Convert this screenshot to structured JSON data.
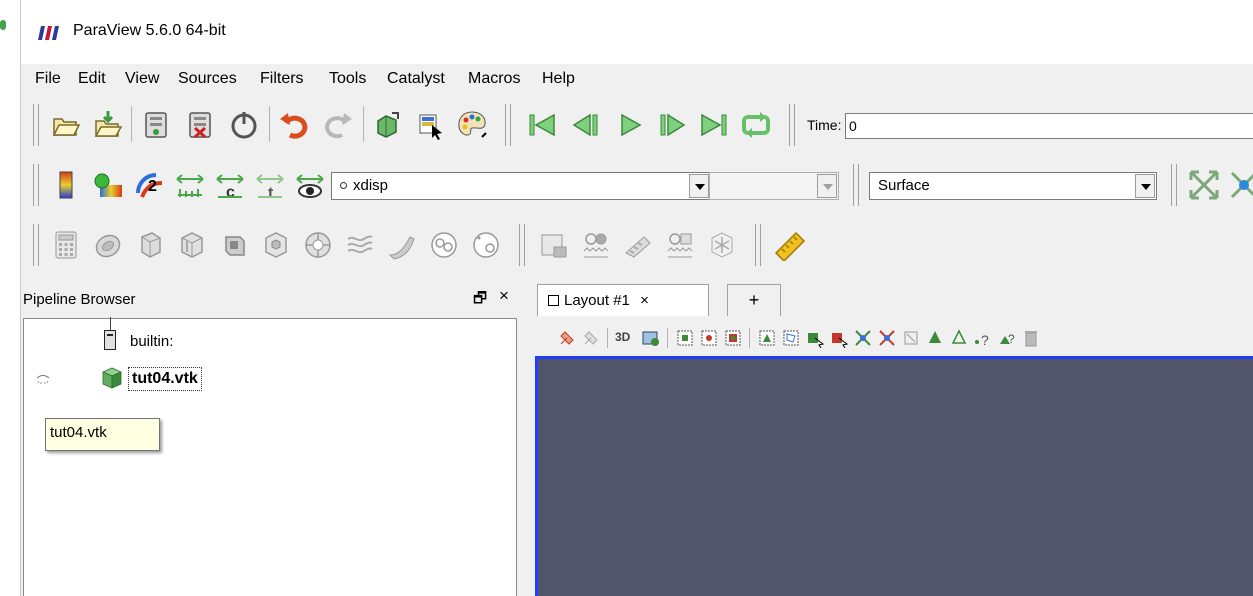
{
  "window": {
    "title": "ParaView 5.6.0 64-bit"
  },
  "menu": [
    "File",
    "Edit",
    "View",
    "Sources",
    "Filters",
    "Tools",
    "Catalyst",
    "Macros",
    "Help"
  ],
  "toolbar": {
    "time_label": "Time:",
    "time_value": "0",
    "array_selector": "xdisp",
    "component_selector": "",
    "representation": "Surface"
  },
  "pipeline": {
    "title": "Pipeline Browser",
    "server": "builtin:",
    "source": "tut04.vtk",
    "tooltip": "tut04.vtk"
  },
  "layout": {
    "tab_label": "Layout #1",
    "add_tab": "+",
    "view_3d": "3D",
    "close_glyph": "×",
    "float_glyph": "🗗"
  },
  "colors": {
    "render_background": "#525469",
    "active_view_border": "#1f3fff",
    "tooltip_background": "#ffffe1"
  }
}
